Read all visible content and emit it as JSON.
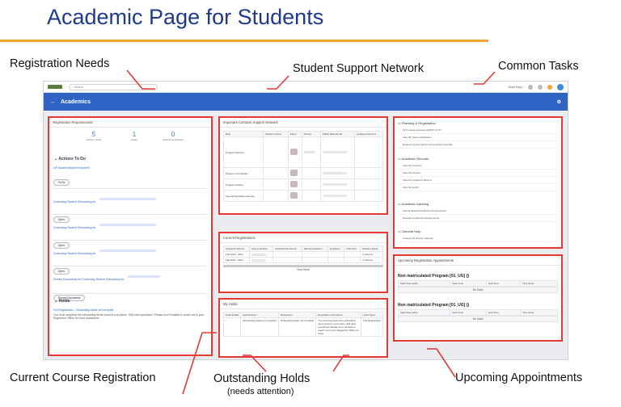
{
  "slide": {
    "title": "Academic Page for Students",
    "accent_color": "#f2a531",
    "title_color": "#1f3a8a",
    "callout_color": "#e53935"
  },
  "callouts": {
    "registration_needs": "Registration Needs",
    "student_support": "Student Support Network",
    "common_tasks": "Common Tasks",
    "current_course": "Current Course Registration",
    "outstanding_holds": "Outstanding Holds",
    "outstanding_holds_sub": "(needs attention)",
    "upcoming_appointments": "Upcoming Appointments"
  },
  "app": {
    "search_placeholder": "Search",
    "help_label": "Need Help?",
    "header_title": "Academics",
    "back_icon": "arrow-left-icon",
    "brand_color": "#2f64c4",
    "registration": {
      "title": "Registration Requirements",
      "stats": [
        {
          "value": "5",
          "label": "Actions To Do"
        },
        {
          "value": "1",
          "label": "Holds"
        },
        {
          "value": "0",
          "label": "Actions Completed"
        }
      ],
      "actions_heading": "Actions To Do",
      "first_link": "UR Student Mobile Enrolment",
      "first_button": "To Do",
      "items": [
        {
          "link": "Continuing Student Onboarding for",
          "button": "Open"
        },
        {
          "link": "Continuing Student Onboarding for",
          "button": "Open"
        },
        {
          "link": "Continuing Student Onboarding for",
          "button": "Open"
        },
        {
          "link": "Review Documents for Continuing Student Onboarding for",
          "button": "Review Documents"
        }
      ],
      "holds_heading": "Holds",
      "holds_link": "Full Registration - Onboarding tasks not complete",
      "holds_text": "You must complete the onboarding items found in your inbox. Still have questions? Please don't hesitate to reach out to your Registrar's Office for more assistance."
    },
    "contacts": {
      "title": "Important Contacts Support Network",
      "columns": [
        "Role",
        "Student Cohort",
        "Photo",
        "Person",
        "Public Work Email",
        "Academic Record"
      ],
      "roles": [
        "Program Director",
        "Program Coordinator",
        "Program Advisor",
        "Special Population Advisor"
      ]
    },
    "current_regs": {
      "title": "Current Registrations",
      "columns": [
        "Academic Period",
        "Course Section",
        "Instructional Format",
        "Meeting Patterns",
        "Locations",
        "Instructor",
        "Delivery Mode"
      ],
      "rows": [
        {
          "period": "Fall 2023 - 2024",
          "mode": "In-Person"
        },
        {
          "period": "Fall 2023 - 2024",
          "mode": "In-Person"
        }
      ],
      "view_more": "View More"
    },
    "holds": {
      "title": "My Holds",
      "columns": [
        "Hold Details",
        "Hold Reason",
        "Description",
        "Resolution Instructions",
        "Hold Types"
      ],
      "row": {
        "reason": "Onboarding tasks not complete",
        "description": "Onboarding tasks not complete",
        "instructions": "You must complete the onboarding items found in your inbox. Still have questions? Please don't hesitate to reach out to your Registrar's Office for more",
        "types": "Full Registration"
      }
    },
    "tasks": {
      "groups": [
        {
          "heading": "Planning & Registration",
          "links": [
            "Find Course Sections (DEPT) 07:07",
            "View My Saved Schedules",
            "Request Course Section Prerequisite Override"
          ]
        },
        {
          "heading": "Academic Records",
          "links": [
            "View My Courses",
            "View My Grades",
            "View My Academic Record",
            "View My Holds"
          ]
        },
        {
          "heading": "Academic Advising",
          "links": [
            "View Evaluated Academic Requirements",
            "Evaluate Academic Requirements"
          ]
        },
        {
          "heading": "General Help",
          "links": [
            "Change My Privacy Settings"
          ]
        }
      ]
    },
    "appointments": {
      "title": "Upcoming Registration Appointments",
      "programs": [
        {
          "name": "Non matriculated Program [01_UG] ()",
          "columns": [
            "Start Date within",
            "Start Time",
            "End Time",
            "Time Zone"
          ],
          "empty": "No Data"
        },
        {
          "name": "Non matriculated Program [01_UG] ()",
          "columns": [
            "Start Date within",
            "Start Time",
            "End Time",
            "Time Zone"
          ],
          "empty": "No Data"
        }
      ]
    }
  }
}
